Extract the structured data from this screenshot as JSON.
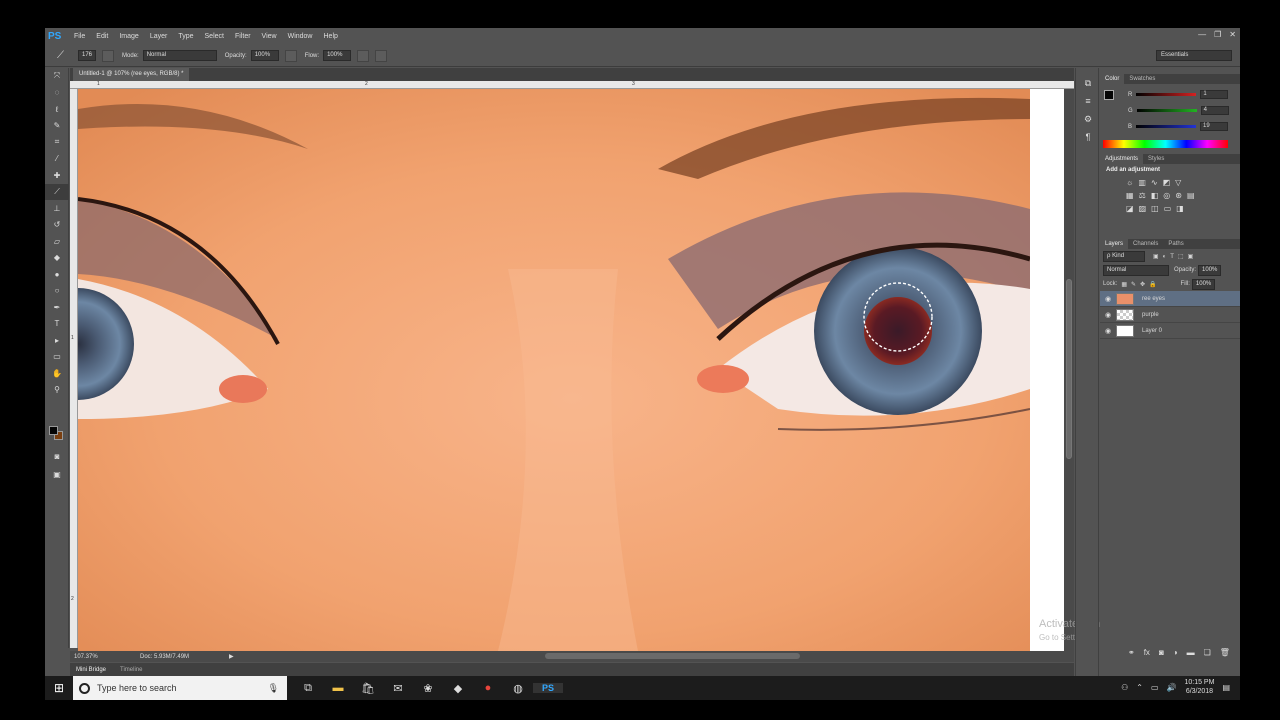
{
  "app": {
    "logo": "PS"
  },
  "menu": [
    "File",
    "Edit",
    "Image",
    "Layer",
    "Type",
    "Select",
    "Filter",
    "View",
    "Window",
    "Help"
  ],
  "window_controls": [
    "—",
    "❐",
    "✕"
  ],
  "options": {
    "brush_size": "176",
    "mode_label": "Mode:",
    "mode_value": "Normal",
    "opacity_label": "Opacity:",
    "opacity_value": "100%",
    "flow_label": "Flow:",
    "flow_value": "100%",
    "workspace": "Essentials"
  },
  "document": {
    "tab_title": "Untitled-1 @ 107% (ree eyes, RGB/8) *",
    "ruler_top": [
      "1",
      "2",
      "3"
    ],
    "ruler_left": [
      "1",
      "2"
    ],
    "zoom": "107.37%",
    "doc_size": "Doc: 5.93M/7.49M"
  },
  "bottom_tabs": [
    "Mini Bridge",
    "Timeline"
  ],
  "watermark": {
    "title": "Activate Windows",
    "subtitle": "Go to Settings to activate Windows."
  },
  "color_panel": {
    "tabs": [
      "Color",
      "Swatches"
    ],
    "channels": [
      {
        "label": "R",
        "value": "1",
        "color": "#d42222"
      },
      {
        "label": "G",
        "value": "4",
        "color": "#22b422"
      },
      {
        "label": "B",
        "value": "19",
        "color": "#2233d4"
      }
    ]
  },
  "adjustments": {
    "tabs": [
      "Adjustments",
      "Styles"
    ],
    "title": "Add an adjustment"
  },
  "layers_panel": {
    "tabs": [
      "Layers",
      "Channels",
      "Paths"
    ],
    "kind": "ρ Kind",
    "blend": "Normal",
    "opacity_label": "Opacity:",
    "opacity_value": "100%",
    "lock_label": "Lock:",
    "fill_label": "Fill:",
    "fill_value": "100%",
    "layers": [
      {
        "name": "ree eyes",
        "selected": true
      },
      {
        "name": "purple",
        "selected": false
      },
      {
        "name": "Layer 0",
        "selected": false
      }
    ]
  },
  "taskbar": {
    "search_placeholder": "Type here to search",
    "time": "10:15 PM",
    "date": "6/3/2018"
  }
}
